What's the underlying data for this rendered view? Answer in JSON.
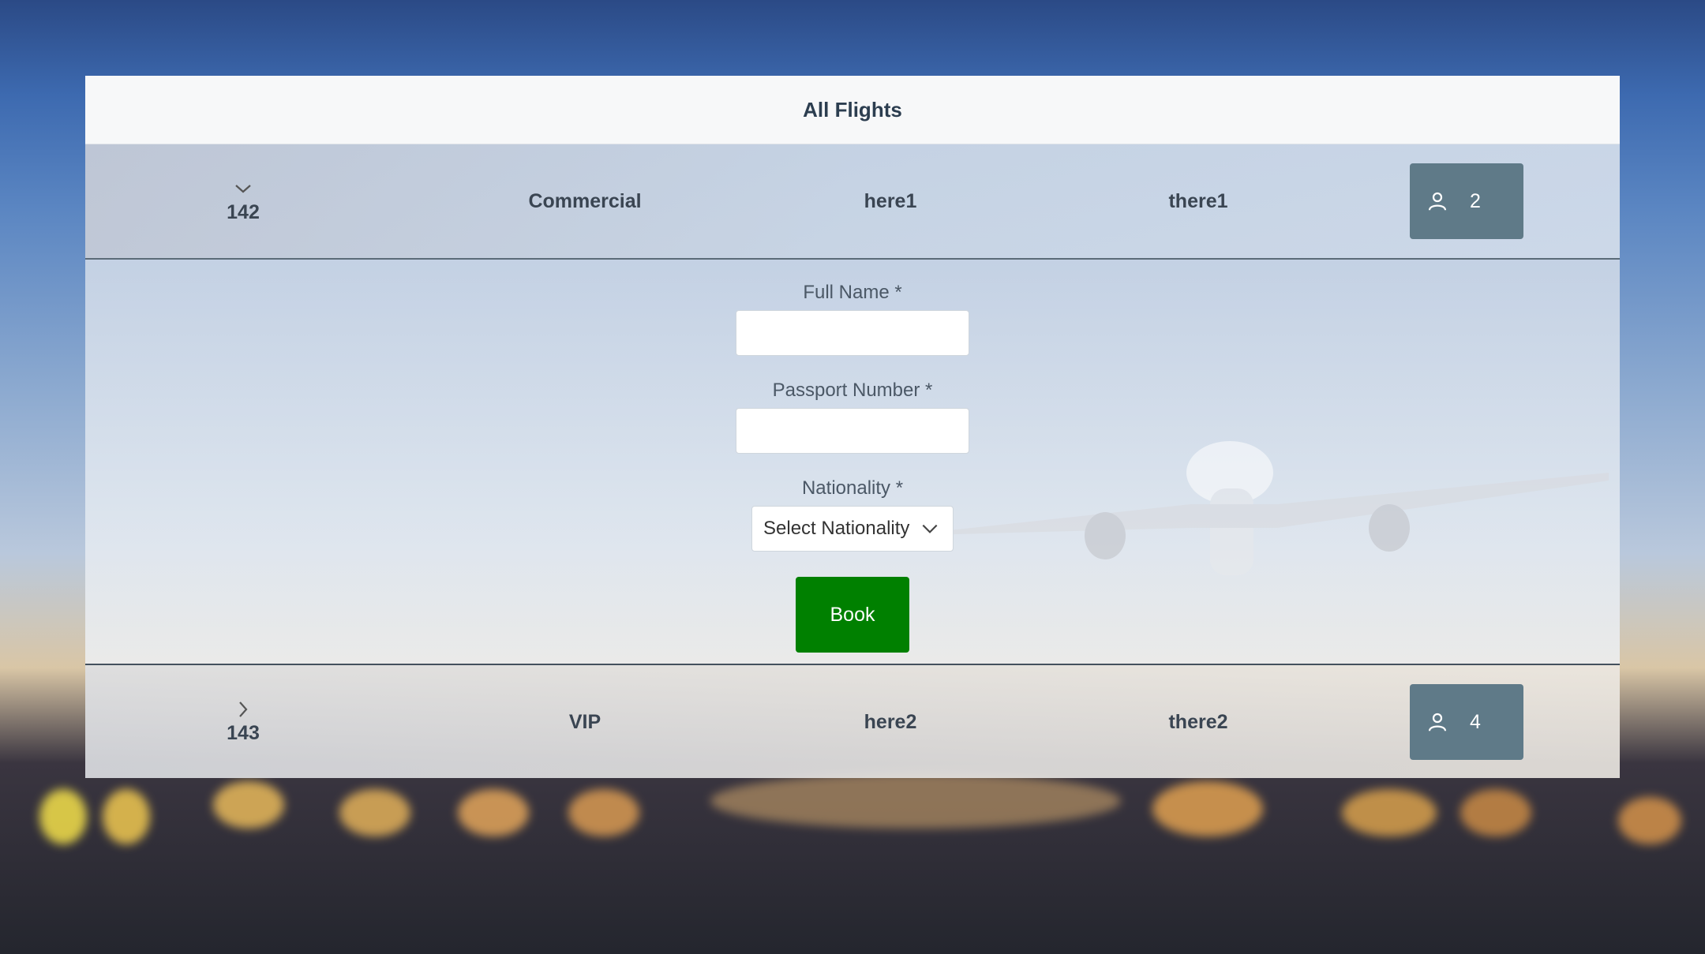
{
  "header": {
    "title": "All Flights"
  },
  "flights": [
    {
      "id": "142",
      "type": "Commercial",
      "from": "here1",
      "to": "there1",
      "passengers": "2",
      "expanded": true
    },
    {
      "id": "143",
      "type": "VIP",
      "from": "here2",
      "to": "there2",
      "passengers": "4",
      "expanded": false
    }
  ],
  "booking_form": {
    "full_name_label": "Full Name  *",
    "full_name_value": "",
    "passport_label": "Passport Number  *",
    "passport_value": "",
    "nationality_label": "Nationality  *",
    "nationality_selected": "Select Nationality",
    "book_label": "Book"
  },
  "colors": {
    "book_button": "#008000",
    "passenger_button": "#5f7a88",
    "header_bg": "#f7f8f9"
  },
  "icons": {
    "expanded": "chevron-down-icon",
    "collapsed": "chevron-right-icon",
    "passengers": "person-icon",
    "dropdown": "chevron-down-icon"
  }
}
